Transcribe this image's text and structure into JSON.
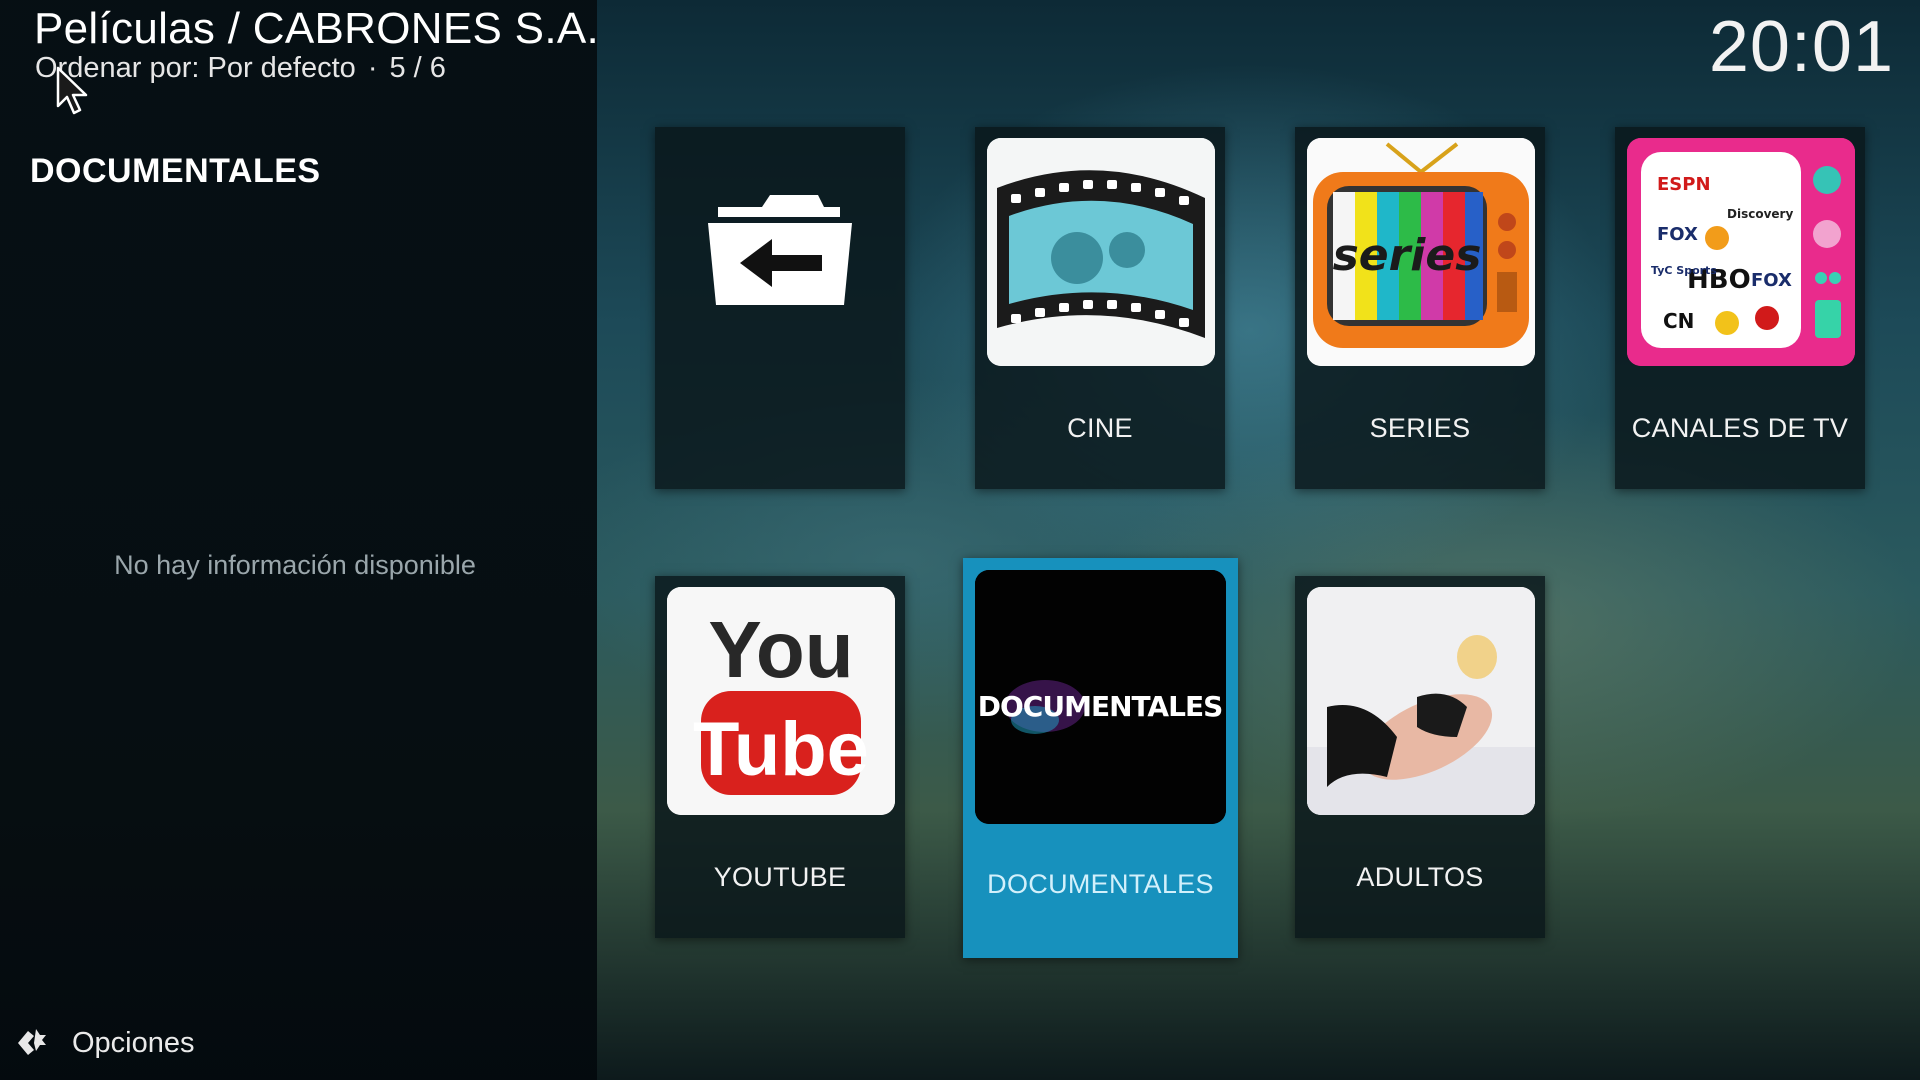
{
  "header": {
    "title": "Películas / CABRONES S.A.",
    "sort_prefix": "Ordenar por:",
    "sort_value": "Por defecto",
    "separator": "·",
    "position": "5 / 6"
  },
  "clock": "20:01",
  "side": {
    "heading": "DOCUMENTALES",
    "info": "No hay información disponible"
  },
  "options": {
    "label": "Opciones",
    "icon": "options-gear-icon"
  },
  "colors": {
    "focus": "#1791bd",
    "tile_bg": "#0a161a"
  },
  "grid": {
    "selected_index": 4,
    "tiles": [
      {
        "label": "",
        "icon": "back-folder-icon"
      },
      {
        "label": "CINE",
        "icon": "film-reel-thumb"
      },
      {
        "label": "SERIES",
        "icon": "retro-tv-thumb",
        "thumb_text": "series"
      },
      {
        "label": "CANALES DE TV",
        "icon": "tv-channels-thumb",
        "thumb_text": [
          "ESPN",
          "FOX",
          "HBO",
          "TyC Sports",
          "Discovery",
          "CN",
          "FOX"
        ]
      },
      {
        "label": "YOUTUBE",
        "icon": "youtube-logo",
        "thumb_text": [
          "You",
          "Tube"
        ]
      },
      {
        "label": "DOCUMENTALES",
        "icon": "documentales-logo",
        "thumb_text": "DOCUMENTALES"
      },
      {
        "label": "ADULTOS",
        "icon": "adult-photo-thumb"
      }
    ]
  }
}
